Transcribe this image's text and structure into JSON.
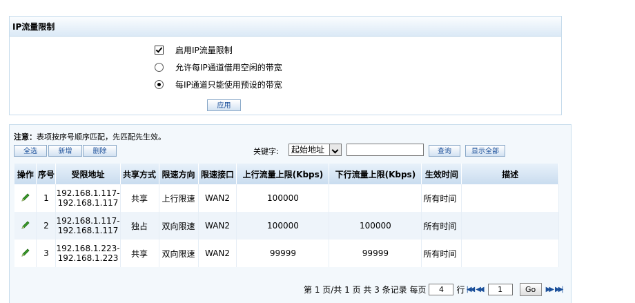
{
  "panel": {
    "title": "IP流量限制",
    "options": [
      {
        "label": "启用IP流量限制",
        "checked": true
      },
      {
        "label": "允许每IP通道借用空闲的带宽",
        "selected": false
      },
      {
        "label": "每IP通道只能使用预设的带宽",
        "selected": true
      }
    ],
    "apply_label": "应用"
  },
  "list": {
    "note_prefix": "注意：",
    "note_text": "表项按序号顺序匹配，先匹配先生效。",
    "select_all": "全选",
    "add": "新增",
    "delete": "删除",
    "keyword_label": "关键字:",
    "keyword_select": "起始地址",
    "keyword_value": "",
    "search": "查询",
    "show_all": "显示全部",
    "headers": [
      "操作",
      "序号",
      "受限地址",
      "共享方式",
      "限速方向",
      "限速接口",
      "上行流量上限(Kbps)",
      "下行流量上限(Kbps)",
      "生效时间",
      "描述"
    ],
    "rows": [
      {
        "seq": "1",
        "addr1": "192.168.1.117-",
        "addr2": "192.168.1.117",
        "share": "共享",
        "dir": "上行限速",
        "iface": "WAN2",
        "up": "100000",
        "down": "",
        "time": "所有时间",
        "desc": ""
      },
      {
        "seq": "2",
        "addr1": "192.168.1.117-",
        "addr2": "192.168.1.117",
        "share": "独占",
        "dir": "双向限速",
        "iface": "WAN2",
        "up": "100000",
        "down": "100000",
        "time": "所有时间",
        "desc": ""
      },
      {
        "seq": "3",
        "addr1": "192.168.1.223-",
        "addr2": "192.168.1.223",
        "share": "共享",
        "dir": "双向限速",
        "iface": "WAN2",
        "up": "99999",
        "down": "99999",
        "time": "所有时间",
        "desc": ""
      }
    ]
  },
  "pager": {
    "text1": "第 1 页/共 1 页 共 3 条记录 每页",
    "per_page": "4",
    "text2": "行",
    "page_value": "1",
    "go": "Go"
  },
  "colors": {
    "accent": "#1a4f9a",
    "header_bg": "#c9dcef"
  }
}
